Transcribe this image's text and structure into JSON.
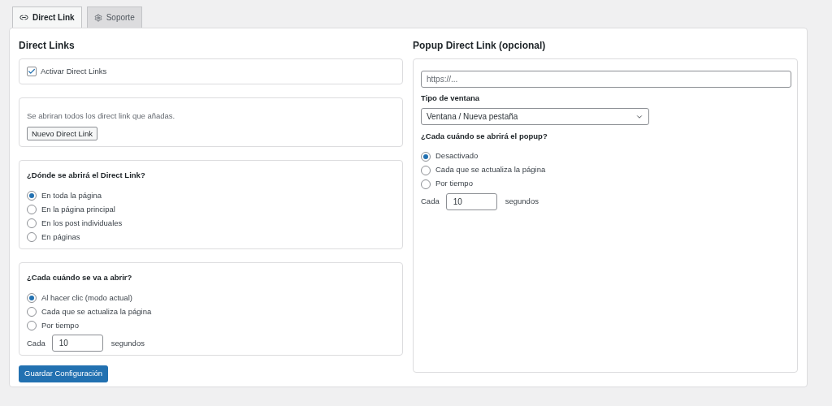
{
  "tabs": [
    {
      "label": "Direct Link",
      "selected": true
    },
    {
      "label": "Soporte",
      "selected": false
    }
  ],
  "left": {
    "title": "Direct Links",
    "activate": {
      "label": "Activar Direct Links",
      "checked": true
    },
    "description": "Se abriran todos los direct link que añadas.",
    "new_button": "Nuevo Direct Link",
    "where": {
      "title": "¿Dónde se abrirá el Direct Link?",
      "options": [
        {
          "label": "En toda la página",
          "selected": true
        },
        {
          "label": "En la página principal",
          "selected": false
        },
        {
          "label": "En los post individuales",
          "selected": false
        },
        {
          "label": "En páginas",
          "selected": false
        }
      ]
    },
    "when": {
      "title": "¿Cada cuándo se va a abrir?",
      "options": [
        {
          "label": "Al hacer clic (modo actual)",
          "selected": true
        },
        {
          "label": "Cada que se actualiza la página",
          "selected": false
        },
        {
          "label": "Por tiempo",
          "selected": false
        }
      ],
      "every_label": "Cada",
      "every_value": "10",
      "unit": "segundos"
    },
    "save_button": "Guardar Configuración"
  },
  "right": {
    "title": "Popup Direct Link (opcional)",
    "url": {
      "placeholder": "https://..."
    },
    "window_type_label": "Tipo de ventana",
    "window_type_value": "Ventana / Nueva pestaña",
    "when": {
      "title": "¿Cada cuándo se abrirá el popup?",
      "options": [
        {
          "label": "Desactivado",
          "selected": true
        },
        {
          "label": "Cada que se actualiza la página",
          "selected": false
        },
        {
          "label": "Por tiempo",
          "selected": false
        }
      ],
      "every_label": "Cada",
      "every_value": "10",
      "unit": "segundos"
    }
  }
}
